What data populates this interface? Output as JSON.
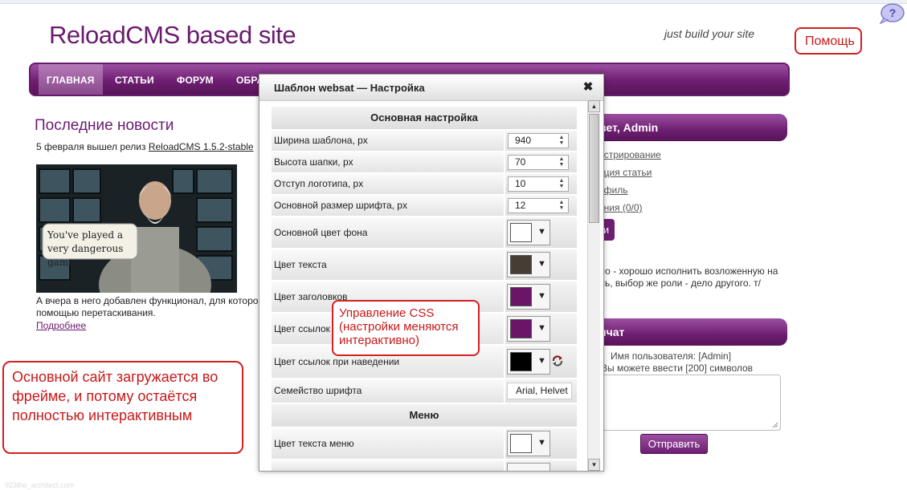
{
  "site": {
    "title": "ReloadCMS based site",
    "slogan": "just build your site"
  },
  "help": {
    "icon": "question-bubble-icon",
    "callout": "Помощь"
  },
  "nav": {
    "items": [
      "ГЛАВНАЯ",
      "СТАТЬИ",
      "ФОРУМ",
      "ОБРА"
    ],
    "active": 0
  },
  "news": {
    "title": "Последние новости",
    "line_prefix": "5 февраля вышел релиз ",
    "link": "ReloadCMS 1.5.2-stable",
    "image_caption": "You've played a very dangerous game",
    "text_line1": "А вчера в него добавлен функционал, для которо",
    "text_line2": "помощью перетаскивания.",
    "more_link": "Подробнее"
  },
  "left_callout": "Основной сайт загружается во фрейме, и потому остаётся полностью интерактивным",
  "sidebar": {
    "welcome_header": "вет, Admin",
    "links": [
      "истрирование",
      "ация статьи",
      "офиль",
      "ения (0/0)"
    ],
    "button_label": "и",
    "quote": "ло - хорошо исполнить возложенную на ль, выбор же роли - дело другого. т/",
    "chat_header": "ичат",
    "user_label": "Имя пользователя: [Admin]",
    "chars_label": "Вы можете ввести [200] символов",
    "send_label": "Отправить"
  },
  "dialog": {
    "title": "Шаблон websat — Настройка",
    "close": "✖",
    "section_main": "Основная настройка",
    "section_menu": "Меню",
    "rows": {
      "width": {
        "label": "Ширина шаблона, px",
        "value": "940"
      },
      "header": {
        "label": "Высота шапки, px",
        "value": "70"
      },
      "logo": {
        "label": "Отступ логотипа, px",
        "value": "10"
      },
      "fontsize": {
        "label": "Основной размер шрифта, px",
        "value": "12"
      },
      "bg": {
        "label": "Основной цвет фона",
        "color": "#ffffff"
      },
      "text": {
        "label": "Цвет текста",
        "color": "#453e35"
      },
      "headings": {
        "label": "Цвет заголовков",
        "color": "#6b1569"
      },
      "links": {
        "label": "Цвет ссылок",
        "color": "#6b1569"
      },
      "hover": {
        "label": "Цвет ссылок при наведении",
        "color": "#000000"
      },
      "font": {
        "label": "Семейство шрифта",
        "value": "Arial, Helvet"
      },
      "menu_text": {
        "label": "Цвет текста меню",
        "color": "#ffffff"
      }
    }
  },
  "css_callout": "Управление CSS (настройки меняются интерактивно)",
  "footer": "923the_architect.com"
}
